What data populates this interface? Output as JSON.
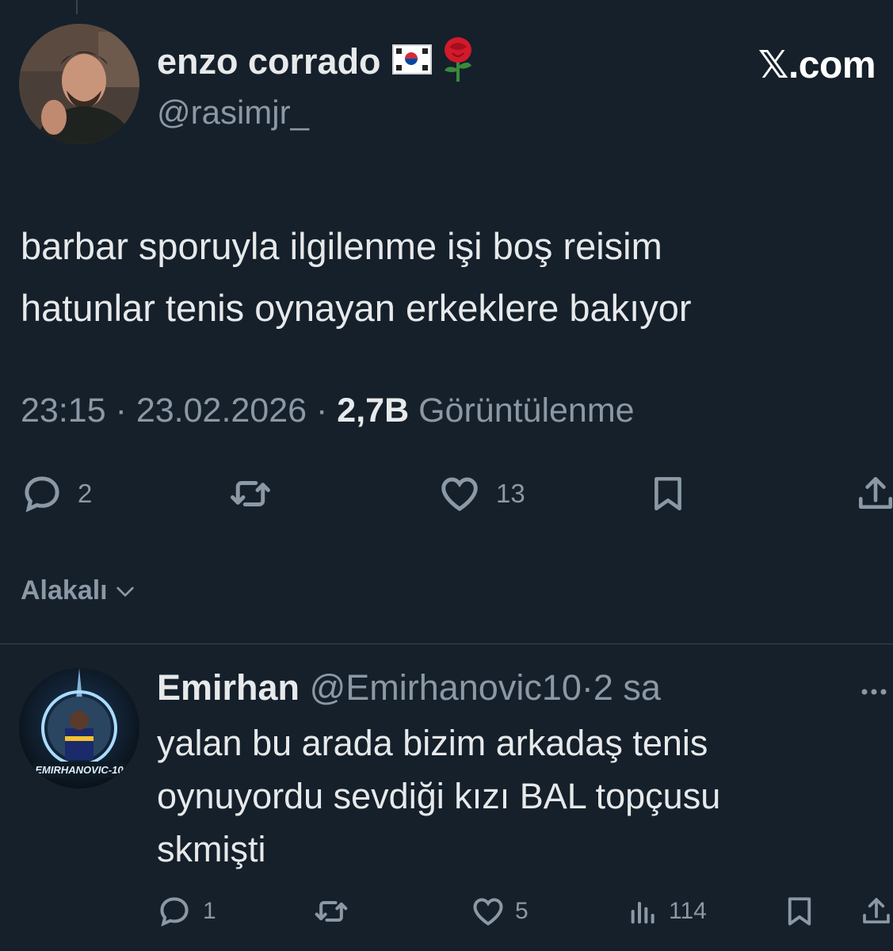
{
  "header": {
    "brand": "𝕏.com"
  },
  "tweet": {
    "author_name": "enzo corrado",
    "author_handle": "@rasimjr_",
    "text_line1": "barbar sporuyla ilgilenme işi boş reisim",
    "text_line2": "hatunlar tenis oynayan erkeklere bakıyor",
    "time": "23:15",
    "date": "23.02.2026",
    "separator": "·",
    "views_count": "2,7B",
    "views_label": "Görüntülenme",
    "replies": "2",
    "retweets": "",
    "likes": "13"
  },
  "filter": {
    "label": "Alakalı"
  },
  "reply": {
    "author_name": "Emirhan",
    "author_handle": "@Emirhanovic10",
    "separator": "·",
    "time_ago": "2 sa",
    "text_line1": "yalan bu arada bizim arkadaş tenis",
    "text_line2": "oynuyordu sevdiği kızı BAL topçusu",
    "text_line3": "skmişti",
    "replies": "1",
    "retweets": "",
    "likes": "5",
    "views": "114",
    "avatar_text": "EMIRHANOVIC-10"
  },
  "icons": {
    "flag": "south-korea-flag-icon",
    "rose": "rose-icon",
    "reply": "speech-bubble-icon",
    "retweet": "retweet-arrows-icon",
    "like": "heart-icon",
    "bookmark": "bookmark-icon",
    "share": "share-upload-icon",
    "views": "bar-chart-icon",
    "more": "ellipsis-icon",
    "chevron": "chevron-down-icon"
  },
  "colors": {
    "background": "#15202b",
    "primary_text": "#e7e9ea",
    "secondary_text": "#8b98a5",
    "divider": "#38444d"
  }
}
